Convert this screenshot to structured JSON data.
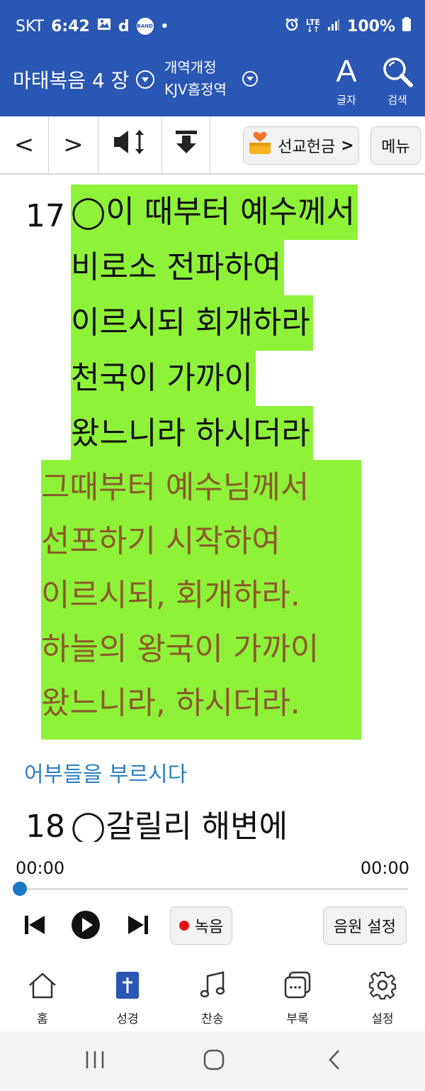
{
  "status_bar": {
    "carrier": "SKT",
    "time": "6:42",
    "app_letter": "d",
    "app_badge": "BAND",
    "dot": "•",
    "network_top": "LTE",
    "network_bottom": "↓↑",
    "battery": "100%"
  },
  "header": {
    "book_chapter": "마태복음 4 장",
    "version_line1": "개역개정",
    "version_line2": "KJV흠정역",
    "font_button_glyph": "A",
    "font_button_label": "글자",
    "search_button_label": "검색",
    "background_color": "#2a56b4"
  },
  "toolbar": {
    "prev_label": "<",
    "next_label": ">",
    "mission_offering_label": "선교헌금",
    "mission_offering_arrow": ">",
    "menu_label": "메뉴"
  },
  "reader": {
    "highlight_color": "#8ef238",
    "alt_text_color": "#8b5a2b",
    "verse17": {
      "number": "17",
      "kjv_lines": [
        "◯이 때부터 예수께서",
        "비로소 전파하여",
        "이르시되 회개하라",
        "천국이 가까이",
        "왔느니라 하시더라"
      ],
      "alt_lines": [
        " 그때부터 예수님께서",
        "선포하기 시작하여",
        "이르시되, 회개하라.",
        "하늘의 왕국이 가까이",
        "왔느니라, 하시더라."
      ]
    },
    "section_heading": "어부들을 부르시다",
    "verse18": {
      "number": "18",
      "first_line": "◯갈릴리 해변에"
    }
  },
  "player": {
    "elapsed": "00:00",
    "total": "00:00",
    "progress": 0,
    "record_label": "녹음",
    "audio_settings_label": "음원 설정"
  },
  "bottom_nav": {
    "items": [
      {
        "label": "홈",
        "icon": "home-icon"
      },
      {
        "label": "성경",
        "icon": "bible-icon"
      },
      {
        "label": "찬송",
        "icon": "music-note-icon"
      },
      {
        "label": "부록",
        "icon": "appendix-icon"
      },
      {
        "label": "설정",
        "icon": "gear-icon"
      }
    ]
  }
}
